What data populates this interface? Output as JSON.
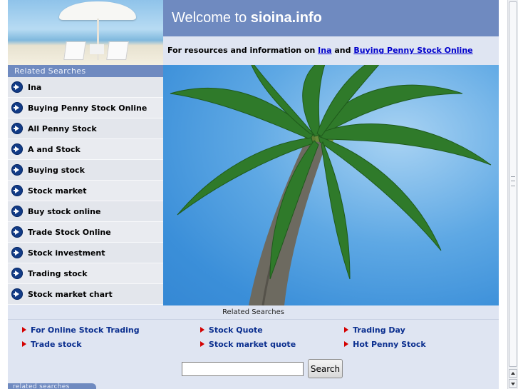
{
  "header": {
    "welcome_prefix": "Welcome to ",
    "site_name": "sioina.info",
    "resources_prefix": "For resources and information on ",
    "resources_link1": "Ina",
    "resources_and": " and ",
    "resources_link2": "Buying Penny Stock Online"
  },
  "sidebar": {
    "header": "Related Searches",
    "items": [
      {
        "label": "Ina"
      },
      {
        "label": "Buying Penny Stock Online"
      },
      {
        "label": "All Penny Stock"
      },
      {
        "label": "A and Stock"
      },
      {
        "label": "Buying stock"
      },
      {
        "label": "Stock market"
      },
      {
        "label": "Buy stock online"
      },
      {
        "label": "Trade Stock Online"
      },
      {
        "label": "Stock investment"
      },
      {
        "label": "Trading stock"
      },
      {
        "label": "Stock market chart"
      }
    ]
  },
  "related": {
    "title": "Related Searches",
    "rows": [
      [
        "For Online Stock Trading",
        "Stock Quote",
        "Trading Day"
      ],
      [
        "Trade stock",
        "Stock market quote",
        "Hot Penny Stock"
      ]
    ]
  },
  "search": {
    "input_value": "",
    "button_label": "Search"
  },
  "footer": {
    "tab_label": "related searches"
  },
  "colors": {
    "header_blue": "#6f8ac0",
    "page_bg": "#dfe5f2",
    "link_blue": "#0b2f8f",
    "bullet_red": "#d40000"
  }
}
